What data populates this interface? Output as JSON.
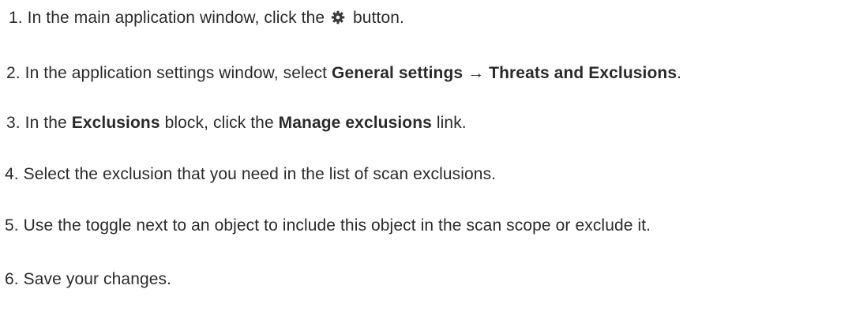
{
  "steps": [
    {
      "number": "1.",
      "text_before": "In the main application window, click the",
      "icon": "gear-icon",
      "text_after": "button."
    },
    {
      "number": "2.",
      "text_before": "In the application settings window, select",
      "bold_1": "General settings",
      "arrow": "→",
      "bold_2": "Threats and Exclusions",
      "text_after": "."
    },
    {
      "number": "3.",
      "text_before": "In the",
      "bold_1": "Exclusions",
      "text_middle": "block, click the",
      "bold_2": "Manage exclusions",
      "text_after": "link."
    },
    {
      "number": "4.",
      "text": "Select the exclusion that you need in the list of scan exclusions."
    },
    {
      "number": "5.",
      "text": "Use the toggle next to an object to include this object in the scan scope or exclude it."
    },
    {
      "number": "6.",
      "text": "Save your changes."
    }
  ]
}
